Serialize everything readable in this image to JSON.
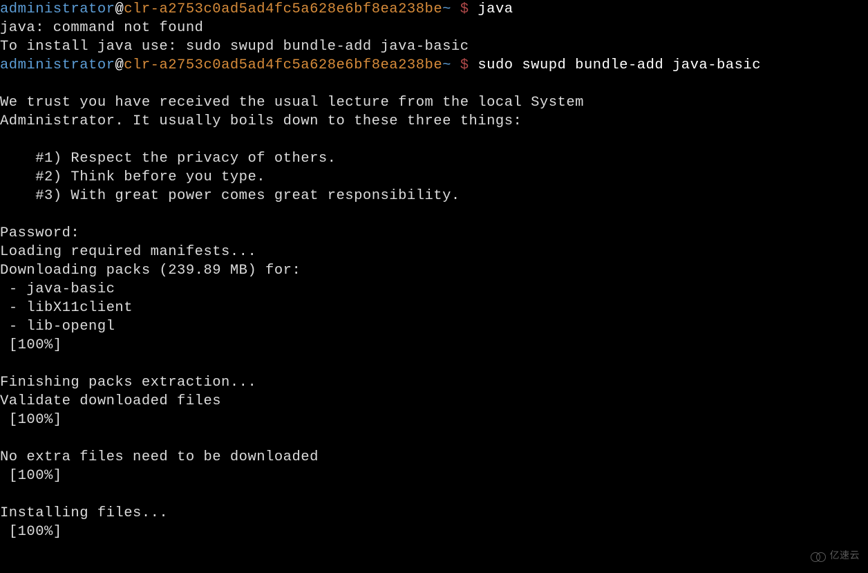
{
  "prompt1": {
    "user": "administrator",
    "at": "@",
    "host": "clr-a2753c0ad5ad4fc5a628e6bf8ea238be",
    "tilde": "~",
    "dollar": " $ ",
    "command": "java"
  },
  "output1_line1": "java: command not found",
  "output1_line2": "To install java use: sudo swupd bundle-add java-basic",
  "prompt2": {
    "user": "administrator",
    "at": "@",
    "host": "clr-a2753c0ad5ad4fc5a628e6bf8ea238be",
    "tilde": "~",
    "dollar": " $ ",
    "command": "sudo swupd bundle-add java-basic"
  },
  "blank1": "",
  "lecture_line1": "We trust you have received the usual lecture from the local System",
  "lecture_line2": "Administrator. It usually boils down to these three things:",
  "blank2": "",
  "rule1": "    #1) Respect the privacy of others.",
  "rule2": "    #2) Think before you type.",
  "rule3": "    #3) With great power comes great responsibility.",
  "blank3": "",
  "password": "Password:",
  "loading": "Loading required manifests...",
  "downloading": "Downloading packs (239.89 MB) for:",
  "pack1": " - java-basic",
  "pack2": " - libX11client",
  "pack3": " - lib-opengl",
  "progress1": " [100%]",
  "blank4": "",
  "finishing": "Finishing packs extraction...",
  "validate": "Validate downloaded files",
  "progress2": " [100%]",
  "blank5": "",
  "noextra": "No extra files need to be downloaded",
  "progress3": " [100%]",
  "blank6": "",
  "installing": "Installing files...",
  "progress4": " [100%]",
  "watermark_text": "亿速云"
}
